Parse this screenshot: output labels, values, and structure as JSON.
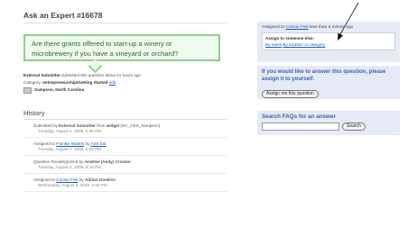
{
  "page": {
    "title": "Ask an Expert #16678",
    "question": "Are there grants offered to start-up a winery or microbrewery if you have a vineyard or orchard?"
  },
  "meta": {
    "submitter": "External Submitter",
    "submitted_text": "submitted this question about 21 hours ago",
    "category_label": "Category:",
    "category_value": "entrepreneurship/Getting Started",
    "edit_link": "edit",
    "location": "Sampson, North Carolina"
  },
  "history": {
    "heading": "History",
    "items": [
      {
        "prefix": "Submitted by ",
        "actor": "External Submitter",
        "mid": " from ",
        "target": "widget",
        "suffix": " (NC_CES_Sampson)",
        "date": "Tuesday, August 4, 2009, 5:06 PM",
        "actor_link": false,
        "target_link": false
      },
      {
        "prefix": "Assigned to ",
        "actor": "Frankie Waters",
        "mid": " by ",
        "target": "ASK-bot",
        "suffix": "",
        "date": "Tuesday, August 4, 2009, 5:06 PM",
        "actor_link": true,
        "target_link": true
      },
      {
        "prefix": "Question Recategorized by ",
        "actor": "Andrew (Andy) Crocker",
        "mid": "",
        "target": "",
        "suffix": "",
        "date": "Tuesday, August 4, 2009, 6:18 PM",
        "actor_link": false,
        "target_link": false
      },
      {
        "prefix": "Assigned to ",
        "actor": "Connie Fisk",
        "mid": " by ",
        "target": "Adrian Goskins",
        "suffix": "",
        "date": "Wednesday, August 5, 2009, 2:59 PM",
        "actor_link": true,
        "target_link": false
      }
    ]
  },
  "sidebar": {
    "assigned_prefix": "Assigned to ",
    "assigned_name": "Connie Fisk",
    "assigned_suffix": " less than a minute ago",
    "assign_heading": "Assign to someone else:",
    "by_name": "By name",
    "by_location": "By location or category",
    "answer_prompt": "If you would like to answer this question, please assign it to yourself.",
    "assign_me_button": "Assign me this question",
    "search_heading": "Search FAQs for an answer",
    "search_button": "Search"
  },
  "colors": {
    "accent": "#3a62b0",
    "question_border": "#8fd08f",
    "sidebar_bg": "#e6eaf6"
  }
}
